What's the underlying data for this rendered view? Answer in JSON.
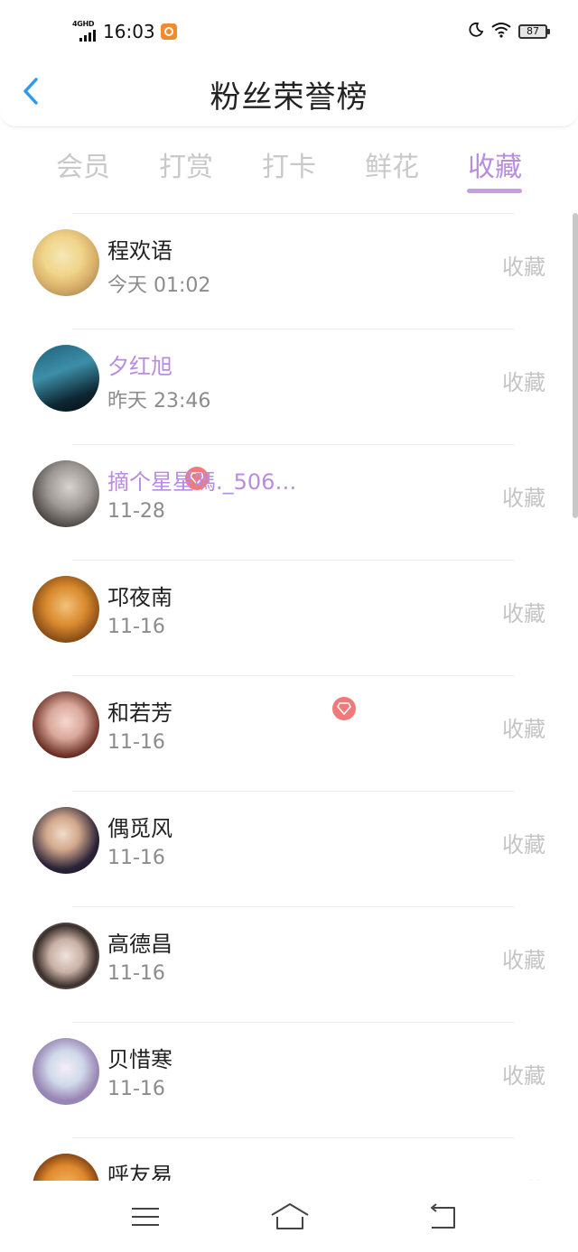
{
  "status_bar": {
    "network": "4GHD",
    "time": "16:03",
    "battery": "87",
    "icons": [
      "signal-icon",
      "app-notification-icon",
      "moon-icon",
      "wifi-icon",
      "battery-icon"
    ]
  },
  "header": {
    "title": "粉丝荣誉榜",
    "back_icon": "chevron-left-icon"
  },
  "tabs": [
    {
      "label": "会员",
      "active": false
    },
    {
      "label": "打赏",
      "active": false
    },
    {
      "label": "打卡",
      "active": false
    },
    {
      "label": "鲜花",
      "active": false
    },
    {
      "label": "收藏",
      "active": true
    }
  ],
  "list": [
    {
      "name": "程欢语",
      "time": "今天  01:02",
      "action": "收藏",
      "vip": false
    },
    {
      "name": "夕红旭",
      "time": "昨天  23:46",
      "action": "收藏",
      "vip": true
    },
    {
      "name": "摘个星星嗎._506…",
      "time": "11-28",
      "action": "收藏",
      "vip": true
    },
    {
      "name": "邛夜南",
      "time": "11-16",
      "action": "收藏",
      "vip": false
    },
    {
      "name": "和若芳",
      "time": "11-16",
      "action": "收藏",
      "vip": false
    },
    {
      "name": "偶觅风",
      "time": "11-16",
      "action": "收藏",
      "vip": false
    },
    {
      "name": "高德昌",
      "time": "11-16",
      "action": "收藏",
      "vip": false
    },
    {
      "name": "贝惜寒",
      "time": "11-16",
      "action": "收藏",
      "vip": false
    },
    {
      "name": "呼友易",
      "time": "",
      "action": "收藏",
      "vip": false
    }
  ],
  "colors": {
    "accent": "#b88de0",
    "badge": "#f07a7a",
    "muted": "#c4c4c4"
  },
  "navbar": [
    "menu-icon",
    "home-icon",
    "back-icon"
  ]
}
